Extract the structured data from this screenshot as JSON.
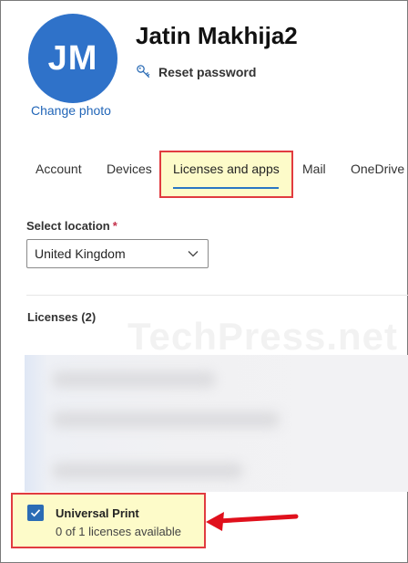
{
  "profile": {
    "initials": "JM",
    "name": "Jatin Makhija2",
    "change_photo": "Change photo",
    "reset_password": "Reset password"
  },
  "tabs": [
    {
      "label": "Account",
      "active": false
    },
    {
      "label": "Devices",
      "active": false
    },
    {
      "label": "Licenses and apps",
      "active": true
    },
    {
      "label": "Mail",
      "active": false
    },
    {
      "label": "OneDrive",
      "active": false
    }
  ],
  "location": {
    "label": "Select location",
    "required_mark": "*",
    "value": "United Kingdom"
  },
  "licenses": {
    "header": "Licenses (2)",
    "items": [
      {
        "name": "Universal Print",
        "status": "0 of 1 licenses available",
        "checked": true
      }
    ]
  },
  "watermark": "TechPress.net",
  "colors": {
    "accent": "#2b77c4",
    "avatar": "#2f72c9",
    "highlight_fill": "#fdfbc9",
    "highlight_border": "#e13b40",
    "arrow": "#e0101c"
  }
}
